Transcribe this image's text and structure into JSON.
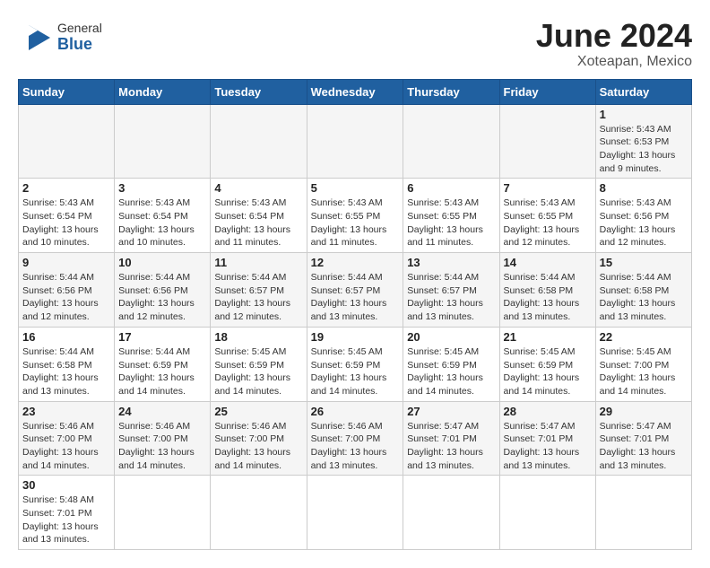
{
  "header": {
    "logo_general": "General",
    "logo_blue": "Blue",
    "month": "June 2024",
    "location": "Xoteapan, Mexico"
  },
  "weekdays": [
    "Sunday",
    "Monday",
    "Tuesday",
    "Wednesday",
    "Thursday",
    "Friday",
    "Saturday"
  ],
  "weeks": [
    [
      {
        "day": "",
        "info": ""
      },
      {
        "day": "",
        "info": ""
      },
      {
        "day": "",
        "info": ""
      },
      {
        "day": "",
        "info": ""
      },
      {
        "day": "",
        "info": ""
      },
      {
        "day": "",
        "info": ""
      },
      {
        "day": "1",
        "info": "Sunrise: 5:43 AM\nSunset: 6:53 PM\nDaylight: 13 hours\nand 9 minutes."
      }
    ],
    [
      {
        "day": "2",
        "info": "Sunrise: 5:43 AM\nSunset: 6:54 PM\nDaylight: 13 hours\nand 10 minutes."
      },
      {
        "day": "3",
        "info": "Sunrise: 5:43 AM\nSunset: 6:54 PM\nDaylight: 13 hours\nand 10 minutes."
      },
      {
        "day": "4",
        "info": "Sunrise: 5:43 AM\nSunset: 6:54 PM\nDaylight: 13 hours\nand 11 minutes."
      },
      {
        "day": "5",
        "info": "Sunrise: 5:43 AM\nSunset: 6:55 PM\nDaylight: 13 hours\nand 11 minutes."
      },
      {
        "day": "6",
        "info": "Sunrise: 5:43 AM\nSunset: 6:55 PM\nDaylight: 13 hours\nand 11 minutes."
      },
      {
        "day": "7",
        "info": "Sunrise: 5:43 AM\nSunset: 6:55 PM\nDaylight: 13 hours\nand 12 minutes."
      },
      {
        "day": "8",
        "info": "Sunrise: 5:43 AM\nSunset: 6:56 PM\nDaylight: 13 hours\nand 12 minutes."
      }
    ],
    [
      {
        "day": "9",
        "info": "Sunrise: 5:44 AM\nSunset: 6:56 PM\nDaylight: 13 hours\nand 12 minutes."
      },
      {
        "day": "10",
        "info": "Sunrise: 5:44 AM\nSunset: 6:56 PM\nDaylight: 13 hours\nand 12 minutes."
      },
      {
        "day": "11",
        "info": "Sunrise: 5:44 AM\nSunset: 6:57 PM\nDaylight: 13 hours\nand 12 minutes."
      },
      {
        "day": "12",
        "info": "Sunrise: 5:44 AM\nSunset: 6:57 PM\nDaylight: 13 hours\nand 13 minutes."
      },
      {
        "day": "13",
        "info": "Sunrise: 5:44 AM\nSunset: 6:57 PM\nDaylight: 13 hours\nand 13 minutes."
      },
      {
        "day": "14",
        "info": "Sunrise: 5:44 AM\nSunset: 6:58 PM\nDaylight: 13 hours\nand 13 minutes."
      },
      {
        "day": "15",
        "info": "Sunrise: 5:44 AM\nSunset: 6:58 PM\nDaylight: 13 hours\nand 13 minutes."
      }
    ],
    [
      {
        "day": "16",
        "info": "Sunrise: 5:44 AM\nSunset: 6:58 PM\nDaylight: 13 hours\nand 13 minutes."
      },
      {
        "day": "17",
        "info": "Sunrise: 5:44 AM\nSunset: 6:59 PM\nDaylight: 13 hours\nand 14 minutes."
      },
      {
        "day": "18",
        "info": "Sunrise: 5:45 AM\nSunset: 6:59 PM\nDaylight: 13 hours\nand 14 minutes."
      },
      {
        "day": "19",
        "info": "Sunrise: 5:45 AM\nSunset: 6:59 PM\nDaylight: 13 hours\nand 14 minutes."
      },
      {
        "day": "20",
        "info": "Sunrise: 5:45 AM\nSunset: 6:59 PM\nDaylight: 13 hours\nand 14 minutes."
      },
      {
        "day": "21",
        "info": "Sunrise: 5:45 AM\nSunset: 6:59 PM\nDaylight: 13 hours\nand 14 minutes."
      },
      {
        "day": "22",
        "info": "Sunrise: 5:45 AM\nSunset: 7:00 PM\nDaylight: 13 hours\nand 14 minutes."
      }
    ],
    [
      {
        "day": "23",
        "info": "Sunrise: 5:46 AM\nSunset: 7:00 PM\nDaylight: 13 hours\nand 14 minutes."
      },
      {
        "day": "24",
        "info": "Sunrise: 5:46 AM\nSunset: 7:00 PM\nDaylight: 13 hours\nand 14 minutes."
      },
      {
        "day": "25",
        "info": "Sunrise: 5:46 AM\nSunset: 7:00 PM\nDaylight: 13 hours\nand 14 minutes."
      },
      {
        "day": "26",
        "info": "Sunrise: 5:46 AM\nSunset: 7:00 PM\nDaylight: 13 hours\nand 13 minutes."
      },
      {
        "day": "27",
        "info": "Sunrise: 5:47 AM\nSunset: 7:01 PM\nDaylight: 13 hours\nand 13 minutes."
      },
      {
        "day": "28",
        "info": "Sunrise: 5:47 AM\nSunset: 7:01 PM\nDaylight: 13 hours\nand 13 minutes."
      },
      {
        "day": "29",
        "info": "Sunrise: 5:47 AM\nSunset: 7:01 PM\nDaylight: 13 hours\nand 13 minutes."
      }
    ],
    [
      {
        "day": "30",
        "info": "Sunrise: 5:48 AM\nSunset: 7:01 PM\nDaylight: 13 hours\nand 13 minutes."
      },
      {
        "day": "",
        "info": ""
      },
      {
        "day": "",
        "info": ""
      },
      {
        "day": "",
        "info": ""
      },
      {
        "day": "",
        "info": ""
      },
      {
        "day": "",
        "info": ""
      },
      {
        "day": "",
        "info": ""
      }
    ]
  ]
}
